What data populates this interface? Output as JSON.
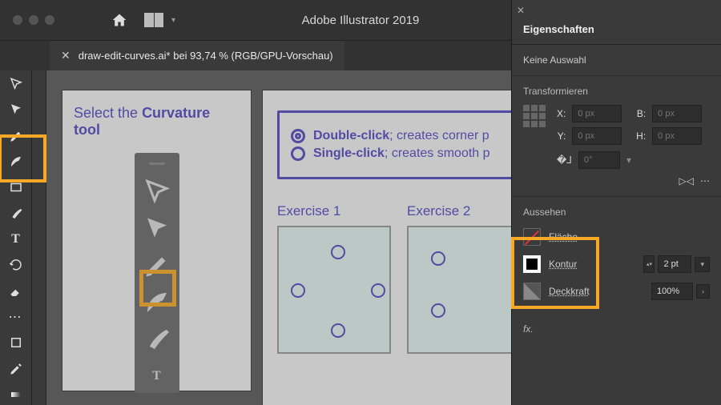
{
  "app_title": "Adobe Illustrator 2019",
  "document": {
    "close_glyph": "✕",
    "tab_label": "draw-edit-curves.ai* bei 93,74 % (RGB/GPU-Vorschau)"
  },
  "artboard1": {
    "title_prefix": "Select the ",
    "title_bold": "Curvature tool"
  },
  "info": {
    "row1_bold": "Double-click",
    "row1_rest": "; creates corner p",
    "row2_bold": "Single-click",
    "row2_rest": "; creates smooth p"
  },
  "exercises": {
    "e1": "Exercise 1",
    "e2": "Exercise 2"
  },
  "props": {
    "tab": "Eigenschaften",
    "no_selection": "Keine Auswahl",
    "transform": "Transformieren",
    "x_label": "X:",
    "y_label": "Y:",
    "b_label": "B:",
    "h_label": "H:",
    "x_val": "0 px",
    "y_val": "0 px",
    "b_val": "0 px",
    "h_val": "0 px",
    "angle_val": "0°",
    "appearance": "Aussehen",
    "fill": "Fläche",
    "stroke": "Kontur",
    "stroke_weight": "2 pt",
    "opacity_label": "Deckkraft",
    "opacity_val": "100%",
    "fx": "fx."
  }
}
